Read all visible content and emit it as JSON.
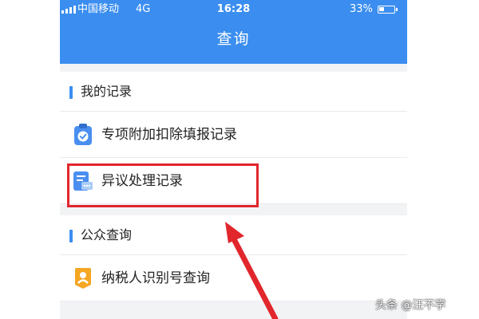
{
  "status_bar": {
    "carrier": "中国移动",
    "network": "4G",
    "time": "16:28",
    "battery": "33%",
    "battery_level": 0.33
  },
  "header": {
    "title": "查询"
  },
  "sections": [
    {
      "title": "我的记录",
      "items": [
        {
          "label": "专项附加扣除填报记录",
          "icon": "clipboard-check-icon"
        },
        {
          "label": "异议处理记录",
          "icon": "dispute-record-icon"
        }
      ]
    },
    {
      "title": "公众查询",
      "items": [
        {
          "label": "纳税人识别号查询",
          "icon": "taxpayer-id-icon"
        }
      ]
    }
  ],
  "annotation": {
    "highlight_color": "#e1262c"
  },
  "watermark": "头条 @汪不学",
  "colors": {
    "primary": "#3b8ef0",
    "icon_orange": "#f5a623",
    "background": "#f2f3f5"
  }
}
